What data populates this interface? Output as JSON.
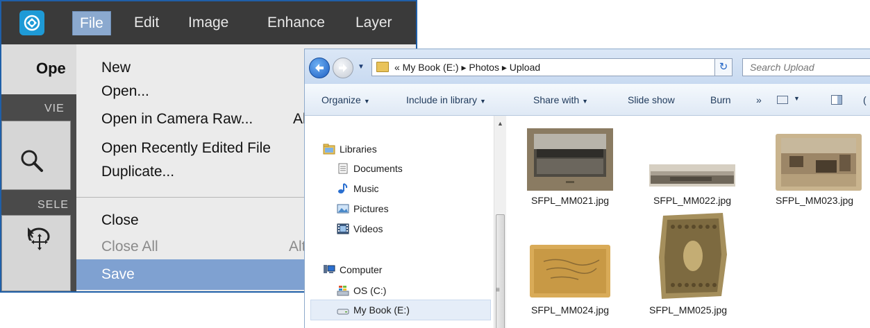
{
  "pse": {
    "menus": [
      "File",
      "Edit",
      "Image",
      "Enhance",
      "Layer"
    ],
    "mode_label": "Ope",
    "view_label": "VIE",
    "select_label": "SELE",
    "file_menu": {
      "items": [
        {
          "label": "New",
          "shortcut": "",
          "disabled": false
        },
        {
          "label": "Open...",
          "shortcut": "",
          "disabled": false
        },
        {
          "label": "Open in Camera Raw...",
          "shortcut": "Al",
          "disabled": false
        },
        {
          "label": "Open Recently Edited File",
          "shortcut": "",
          "disabled": false
        },
        {
          "label": "Duplicate...",
          "shortcut": "",
          "disabled": false
        },
        {
          "label": "Close",
          "shortcut": "",
          "disabled": false
        },
        {
          "label": "Close All",
          "shortcut": "Alt",
          "disabled": true
        },
        {
          "label": "Save",
          "shortcut": "",
          "disabled": false,
          "highlighted": true
        }
      ]
    }
  },
  "explorer": {
    "address_path": "« My Book (E:) ▸ Photos ▸ Upload",
    "search_placeholder": "Search Upload",
    "toolbar": {
      "organize": "Organize",
      "include": "Include in library",
      "share": "Share with",
      "slideshow": "Slide show",
      "burn": "Burn",
      "more": "»",
      "help": "("
    },
    "nav": {
      "libraries": "Libraries",
      "documents": "Documents",
      "music": "Music",
      "pictures": "Pictures",
      "videos": "Videos",
      "computer": "Computer",
      "os": "OS (C:)",
      "mybook": "My Book (E:)"
    },
    "files": [
      {
        "name": "SFPL_MM021.jpg"
      },
      {
        "name": "SFPL_MM022.jpg"
      },
      {
        "name": "SFPL_MM023.jpg"
      },
      {
        "name": "SFPL_MM024.jpg"
      },
      {
        "name": "SFPL_MM025.jpg"
      }
    ]
  },
  "colors": {
    "pse_highlight": "#7fa1d1",
    "pse_menu_active": "#8ba9cf",
    "explorer_selected": "#e5edf8"
  }
}
